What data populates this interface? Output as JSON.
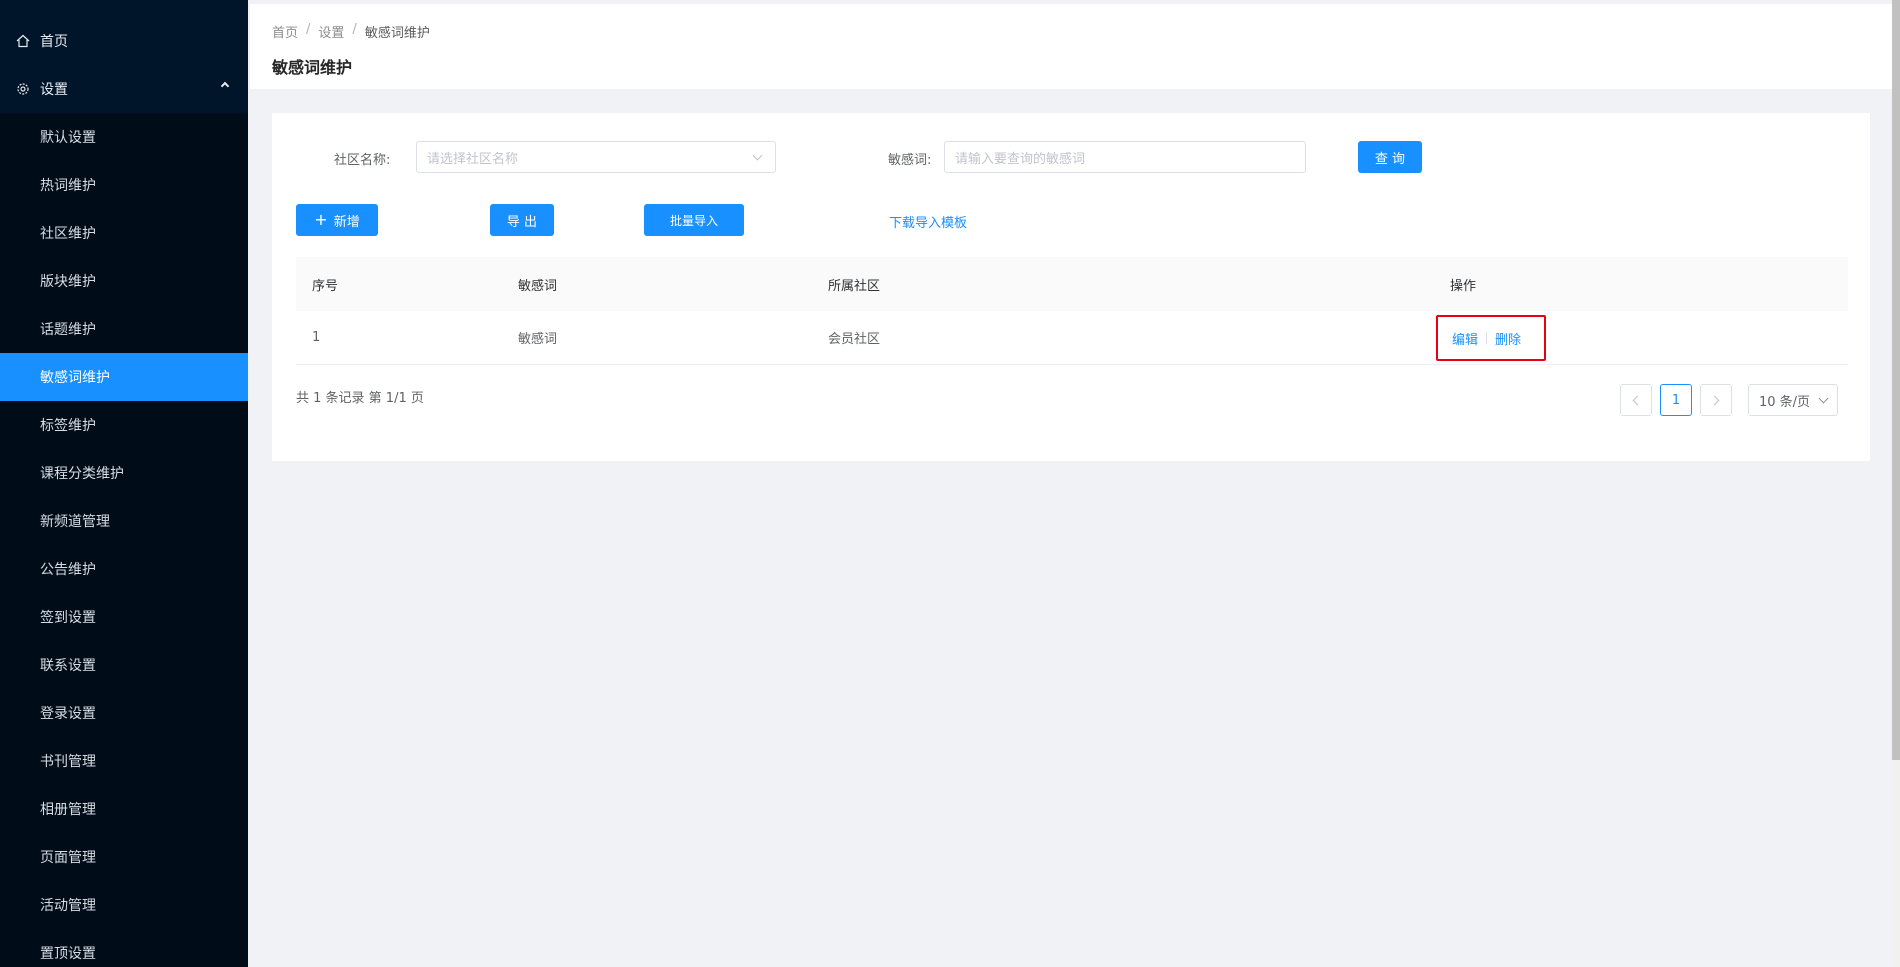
{
  "sidebar": {
    "top_items": [
      {
        "label": "首页",
        "icon": "home-icon"
      },
      {
        "label": "设置",
        "icon": "gear-icon"
      }
    ],
    "sub_items": [
      {
        "label": "默认设置"
      },
      {
        "label": "热词维护"
      },
      {
        "label": "社区维护"
      },
      {
        "label": "版块维护"
      },
      {
        "label": "话题维护"
      },
      {
        "label": "敏感词维护",
        "active": true
      },
      {
        "label": "标签维护"
      },
      {
        "label": "课程分类维护"
      },
      {
        "label": "新频道管理"
      },
      {
        "label": "公告维护"
      },
      {
        "label": "签到设置"
      },
      {
        "label": "联系设置"
      },
      {
        "label": "登录设置"
      },
      {
        "label": "书刊管理"
      },
      {
        "label": "相册管理"
      },
      {
        "label": "页面管理"
      },
      {
        "label": "活动管理"
      },
      {
        "label": "置顶设置"
      }
    ]
  },
  "breadcrumb": [
    "首页",
    "设置",
    "敏感词维护"
  ],
  "page_title": "敏感词维护",
  "filters": {
    "community_label": "社区名称:",
    "community_placeholder": "请选择社区名称",
    "word_label": "敏感词:",
    "word_placeholder": "请输入要查询的敏感词",
    "query_label": "查 询"
  },
  "toolbar": {
    "add_label": "新增",
    "export_label": "导 出",
    "import_label": "批量导入",
    "template_label": "下载导入模板"
  },
  "table": {
    "headers": [
      "序号",
      "敏感词",
      "所属社区",
      "操作"
    ],
    "rows": [
      {
        "index": "1",
        "word": "敏感词",
        "community": "会员社区",
        "edit": "编辑",
        "delete": "删除"
      }
    ]
  },
  "pagination": {
    "summary": "共 1 条记录 第 1/1 页",
    "current_page": "1",
    "page_size": "10 条/页"
  },
  "colors": {
    "sidebar_bg": "#001529",
    "accent": "#1890ff",
    "highlight_border": "#e60012"
  }
}
